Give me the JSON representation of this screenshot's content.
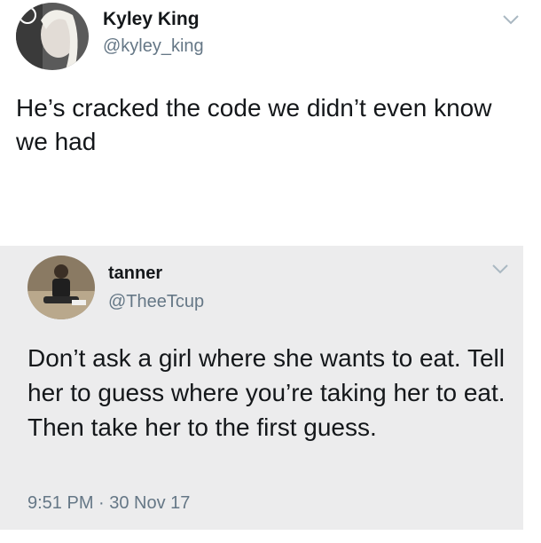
{
  "tweet": {
    "display_name": "Kyley King",
    "handle": "@kyley_king",
    "text": "He’s cracked the code we didn’t even know we had",
    "avatar_icon": "profile-photo",
    "menu_icon": "chevron-down-icon"
  },
  "quoted_tweet": {
    "display_name": "tanner",
    "handle": "@TheeTcup",
    "text": "Don’t ask a girl where she wants to eat. Tell her to guess where you’re taking her to eat. Then take her to the first guess.",
    "timestamp": "9:51 PM · 30 Nov 17",
    "avatar_icon": "profile-photo",
    "menu_icon": "chevron-down-icon"
  },
  "colors": {
    "text": "#14171a",
    "secondary": "#657786",
    "quote_background": "#ececed"
  }
}
